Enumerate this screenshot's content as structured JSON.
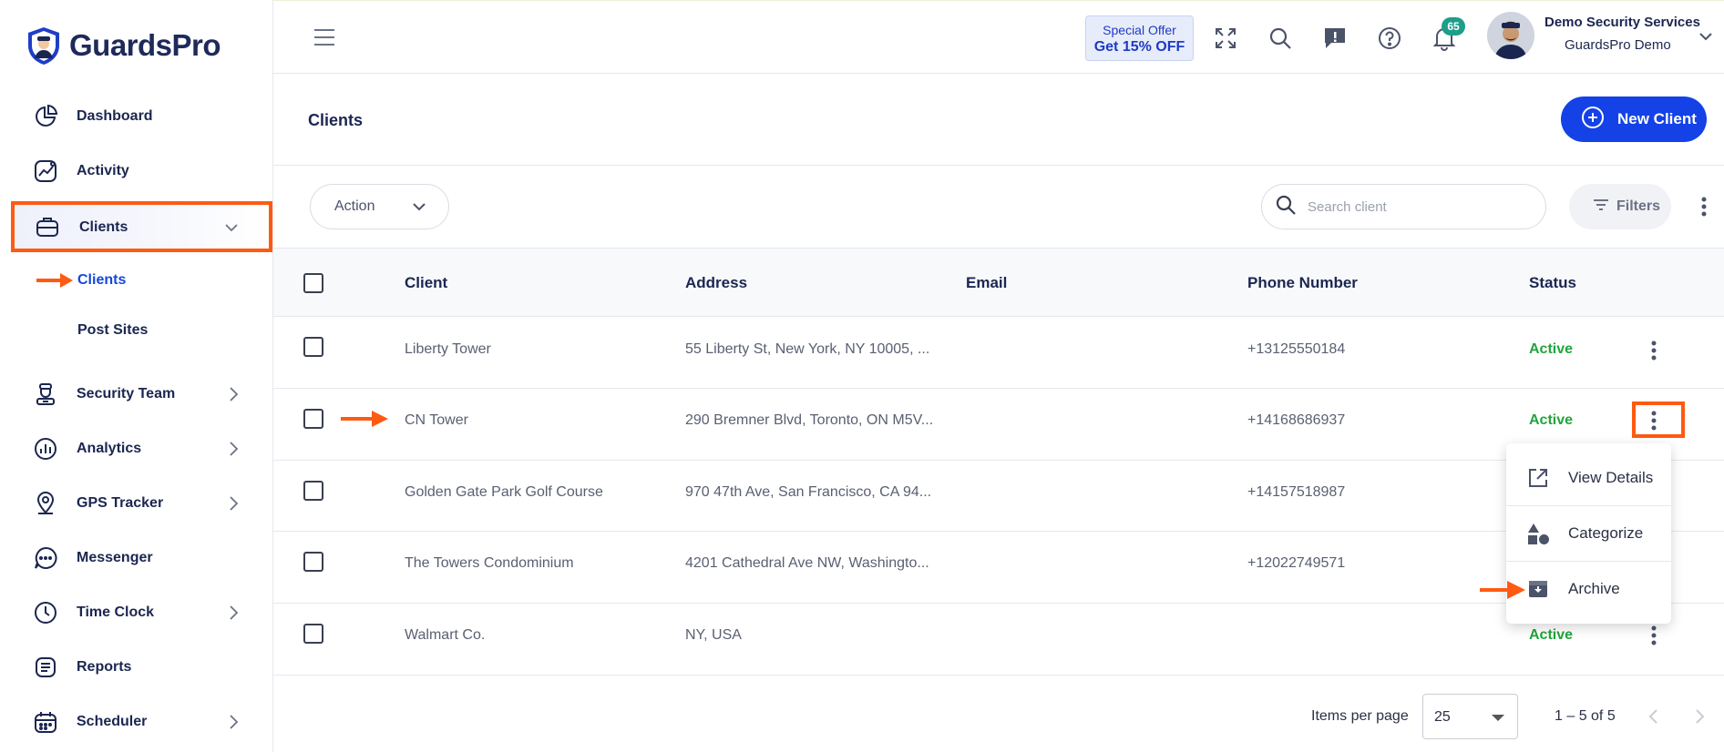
{
  "brand": {
    "name": "GuardsPro"
  },
  "sidebar": {
    "items": [
      {
        "label": "Dashboard",
        "icon": "pie-chart-icon"
      },
      {
        "label": "Activity",
        "icon": "activity-chart-icon"
      },
      {
        "label": "Clients",
        "icon": "briefcase-icon"
      },
      {
        "label": "Security Team",
        "icon": "guard-icon"
      },
      {
        "label": "Analytics",
        "icon": "bar-chart-icon"
      },
      {
        "label": "GPS Tracker",
        "icon": "location-pin-icon"
      },
      {
        "label": "Messenger",
        "icon": "chat-bubble-icon"
      },
      {
        "label": "Time Clock",
        "icon": "clock-icon"
      },
      {
        "label": "Reports",
        "icon": "report-icon"
      },
      {
        "label": "Scheduler",
        "icon": "calendar-icon"
      }
    ],
    "sub_items": [
      {
        "label": "Clients"
      },
      {
        "label": "Post Sites"
      }
    ]
  },
  "topbar": {
    "offer_line1": "Special Offer",
    "offer_line2": "Get 15% OFF",
    "notification_count": "65",
    "user_company": "Demo Security Services",
    "user_name": "GuardsPro Demo"
  },
  "page": {
    "title": "Clients",
    "new_button": "New Client",
    "action_label": "Action",
    "search_placeholder": "Search client",
    "filters_label": "Filters"
  },
  "table": {
    "headers": [
      "Client",
      "Address",
      "Email",
      "Phone Number",
      "Status"
    ],
    "rows": [
      {
        "client": "Liberty Tower",
        "address": "55 Liberty St, New York, NY 10005, ...",
        "email": "",
        "phone": "+13125550184",
        "status": "Active"
      },
      {
        "client": "CN Tower",
        "address": "290 Bremner Blvd, Toronto, ON M5V...",
        "email": "",
        "phone": "+14168686937",
        "status": "Active"
      },
      {
        "client": "Golden Gate Park Golf Course",
        "address": "970 47th Ave, San Francisco, CA 94...",
        "email": "",
        "phone": "+14157518987",
        "status": ""
      },
      {
        "client": "The Towers Condominium",
        "address": "4201 Cathedral Ave NW, Washingto...",
        "email": "",
        "phone": "+12022749571",
        "status": ""
      },
      {
        "client": "Walmart Co.",
        "address": "NY, USA",
        "email": "",
        "phone": "",
        "status": "Active"
      }
    ]
  },
  "context_menu": {
    "items": [
      {
        "label": "View Details",
        "icon": "external-link-icon"
      },
      {
        "label": "Categorize",
        "icon": "shapes-icon"
      },
      {
        "label": "Archive",
        "icon": "archive-icon"
      }
    ]
  },
  "pagination": {
    "items_per_page_label": "Items per page",
    "items_per_page": "25",
    "range": "1 – 5 of 5"
  },
  "colors": {
    "accent": "#1442e6",
    "annotation": "#ff5a12",
    "status_active": "#21a53c",
    "sidebar_text": "#1b2650"
  }
}
